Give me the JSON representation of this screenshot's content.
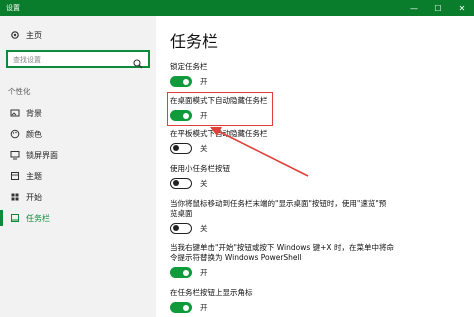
{
  "window": {
    "title": "设置",
    "minimize_glyph": "—",
    "maximize_glyph": "☐",
    "close_glyph": "✕"
  },
  "sidebar": {
    "home": {
      "label": "主页",
      "icon": "gear-icon"
    },
    "search": {
      "placeholder": "查找设置",
      "icon": "search-icon"
    },
    "section": "个性化",
    "items": [
      {
        "label": "背景",
        "icon": "image-icon"
      },
      {
        "label": "颜色",
        "icon": "palette-icon"
      },
      {
        "label": "锁屏界面",
        "icon": "monitor-icon"
      },
      {
        "label": "主题",
        "icon": "theme-icon"
      },
      {
        "label": "开始",
        "icon": "start-icon"
      },
      {
        "label": "任务栏",
        "icon": "taskbar-icon",
        "active": true
      }
    ]
  },
  "main": {
    "title": "任务栏",
    "settings": [
      {
        "label": "锁定任务栏",
        "state": "开",
        "on": true
      },
      {
        "label": "在桌面模式下自动隐藏任务栏",
        "state": "开",
        "on": true
      },
      {
        "label": "在平板模式下自动隐藏任务栏",
        "state": "关",
        "on": false
      },
      {
        "label": "使用小任务栏按钮",
        "state": "关",
        "on": false
      },
      {
        "label_line1": "当你将鼠标移动到任务栏末端的\"显示桌面\"按钮时，使用\"速览\"预",
        "label_line2": "览桌面",
        "state": "关",
        "on": false
      },
      {
        "label_line1": "当我右键单击\"开始\"按钮或按下 Windows 键+X 时，在菜单中将命",
        "label_line2": "令提示符替换为 Windows PowerShell",
        "state": "开",
        "on": true
      },
      {
        "label": "在任务栏按钮上显示角标",
        "state": "开",
        "on": true
      }
    ]
  },
  "colors": {
    "accent": "#0f9a3c",
    "titlebar": "#0a7d2c",
    "annotation": "#e0403a"
  }
}
